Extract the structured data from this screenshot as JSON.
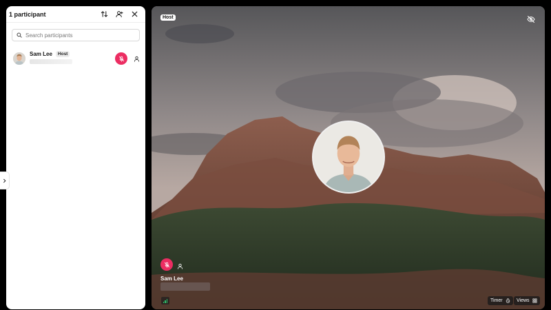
{
  "panel": {
    "title": "1 participant",
    "search_placeholder": "Search participants",
    "participants": [
      {
        "name": "Sam Lee",
        "badge": "Host",
        "muted": true
      }
    ]
  },
  "icons": {
    "sort": "sort-arrows-icon",
    "add_user": "add-user-icon",
    "close": "close-icon",
    "search": "search-icon",
    "mic_off": "mic-off-icon",
    "person": "person-icon",
    "collapse": "chevron-right-icon",
    "hide_video": "eye-off-icon",
    "signal": "signal-icon",
    "timer": "timer-icon",
    "views": "grid-icon"
  },
  "stage": {
    "host_badge": "Host",
    "tile_name": "Sam Lee",
    "timer_label": "Timer",
    "views_label": "Views"
  },
  "colors": {
    "mute_red": "#ec2d62",
    "signal_green": "#2ec46b",
    "panel_bg": "#ffffff",
    "page_bg": "#000000"
  }
}
